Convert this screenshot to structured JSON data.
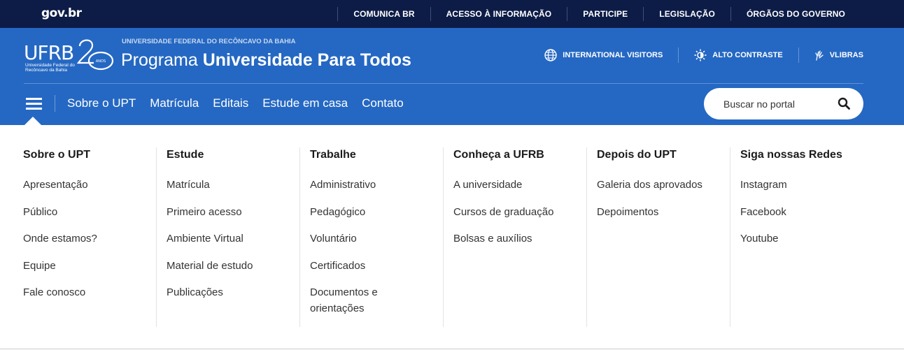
{
  "govbar": {
    "logo": "gov.br",
    "links": [
      "COMUNICA BR",
      "ACESSO À INFORMAÇÃO",
      "PARTICIPE",
      "LEGISLAÇÃO",
      "ÓRGÃOS DO GOVERNO"
    ]
  },
  "brand": {
    "letters": "UFRB",
    "sub_line1": "Universidade Federal do",
    "sub_line2": "Recôncavo da Bahia",
    "anniversary": "20",
    "anniversary_unit": "ANOS"
  },
  "header": {
    "university_name": "UNIVERSIDADE FEDERAL DO RECÔNCAVO DA BAHIA",
    "title_prefix": "Programa",
    "title_bold": "Universidade Para Todos"
  },
  "tools": {
    "international": "INTERNATIONAL VISITORS",
    "contrast": "ALTO CONTRASTE",
    "vlibras": "VLIBRAS"
  },
  "nav": {
    "items": [
      "Sobre o UPT",
      "Matrícula",
      "Editais",
      "Estude em casa",
      "Contato"
    ]
  },
  "search": {
    "placeholder": "Buscar no portal"
  },
  "colors": {
    "govbar_bg": "#0d1c47",
    "header_bg": "#2568c3"
  },
  "mega_menu": [
    {
      "title": "Sobre o UPT",
      "items": [
        "Apresentação",
        "Público",
        "Onde estamos?",
        "Equipe",
        "Fale conosco"
      ]
    },
    {
      "title": "Estude",
      "items": [
        "Matrícula",
        "Primeiro acesso",
        "Ambiente Virtual",
        "Material de estudo",
        "Publicações"
      ]
    },
    {
      "title": "Trabalhe",
      "items": [
        "Administrativo",
        "Pedagógico",
        "Voluntário",
        "Certificados",
        "Documentos e orientações"
      ]
    },
    {
      "title": "Conheça a UFRB",
      "items": [
        "A universidade",
        "Cursos de graduação",
        "Bolsas e auxílios"
      ]
    },
    {
      "title": "Depois do UPT",
      "items": [
        "Galeria dos aprovados",
        "Depoimentos"
      ]
    },
    {
      "title": "Siga nossas Redes",
      "items": [
        "Instagram",
        "Facebook",
        "Youtube"
      ]
    }
  ]
}
